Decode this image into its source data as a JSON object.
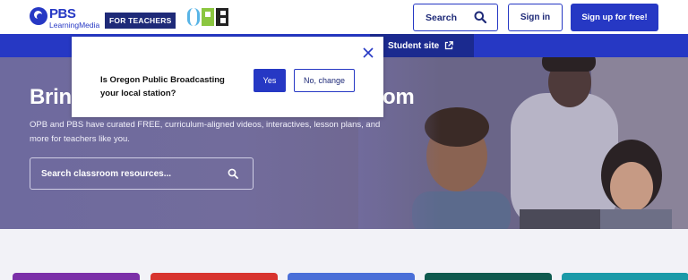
{
  "header": {
    "logo_word": "PBS",
    "logo_sub": "LearningMedia",
    "for_teachers": "FOR TEACHERS",
    "station_logo": "OPB",
    "search_label": "Search",
    "signin_label": "Sign in",
    "signup_label": "Sign up for free!"
  },
  "nav": {
    "student_site": "Student site"
  },
  "hero": {
    "title_start": "Brin",
    "title_end": "om",
    "description": "OPB and PBS have curated FREE, curriculum-aligned videos, interactives, lesson plans, and more for teachers like you.",
    "search_placeholder": "Search classroom resources..."
  },
  "popup": {
    "question": "Is Oregon Public Broadcasting your local station?",
    "yes_label": "Yes",
    "no_label": "No, change"
  },
  "cards": [
    {
      "color": "#7b2fa8"
    },
    {
      "color": "#d8342f"
    },
    {
      "color": "#4a6fd8"
    },
    {
      "color": "#0f5a4f"
    },
    {
      "color": "#1a9aa8"
    }
  ],
  "colors": {
    "brand_blue": "#2638c4",
    "navy": "#1e2a78"
  }
}
